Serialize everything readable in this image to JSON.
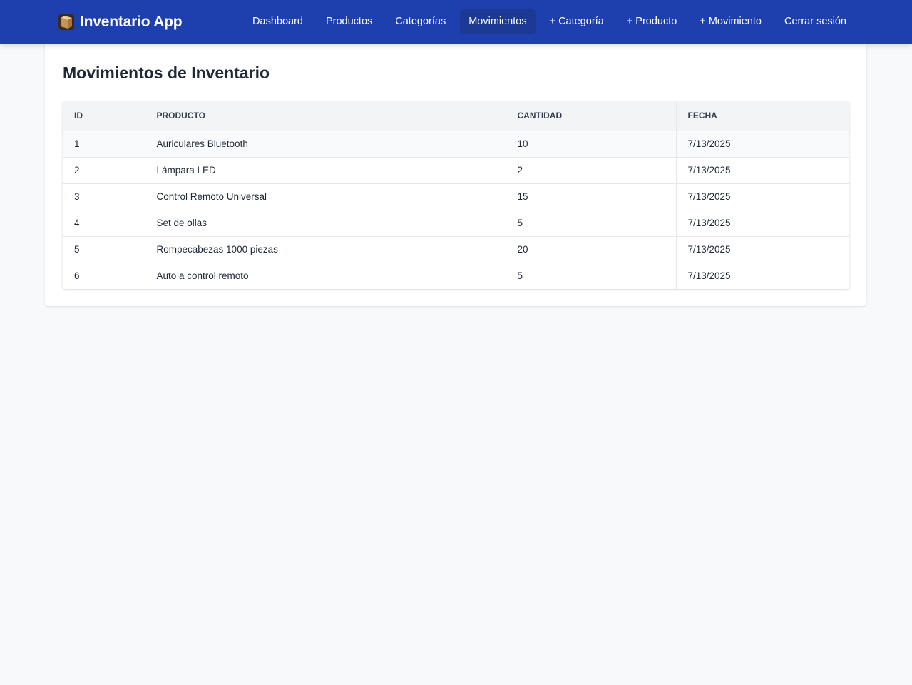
{
  "app": {
    "title": "Inventario App",
    "brand_icon": "package-box-icon"
  },
  "nav": {
    "items": [
      {
        "label": "Dashboard",
        "active": false
      },
      {
        "label": "Productos",
        "active": false
      },
      {
        "label": "Categorías",
        "active": false
      },
      {
        "label": "Movimientos",
        "active": true
      },
      {
        "label": "+ Categoría",
        "active": false
      },
      {
        "label": "+ Producto",
        "active": false
      },
      {
        "label": "+ Movimiento",
        "active": false
      },
      {
        "label": "Cerrar sesión",
        "active": false
      }
    ]
  },
  "page": {
    "title": "Movimientos de Inventario"
  },
  "table": {
    "columns": [
      "ID",
      "PRODUCTO",
      "CANTIDAD",
      "FECHA"
    ],
    "rows": [
      [
        "1",
        "Auriculares Bluetooth",
        "10",
        "7/13/2025"
      ],
      [
        "2",
        "Lámpara LED",
        "2",
        "7/13/2025"
      ],
      [
        "3",
        "Control Remoto Universal",
        "15",
        "7/13/2025"
      ],
      [
        "4",
        "Set de ollas",
        "5",
        "7/13/2025"
      ],
      [
        "5",
        "Rompecabezas 1000 piezas",
        "20",
        "7/13/2025"
      ],
      [
        "6",
        "Auto a control remoto",
        "5",
        "7/13/2025"
      ]
    ]
  },
  "colors": {
    "navbar": "#1e40af",
    "active_nav": "#1c3a93",
    "page_background": "#f8f9fb"
  }
}
